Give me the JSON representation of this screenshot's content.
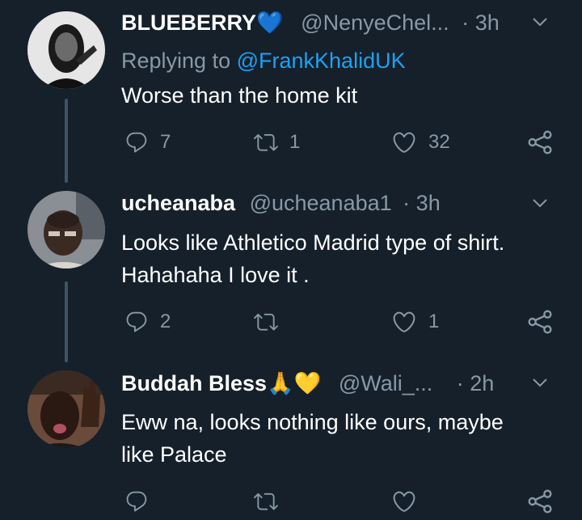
{
  "tweets": [
    {
      "name": "BLUEBERRY",
      "name_emoji": "💙",
      "handle": "@NenyeChel...",
      "dot": "·",
      "time": "3h",
      "replying_prefix": "Replying to",
      "replying_to": "@FrankKhalidUK",
      "text": "Worse than the home kit",
      "replies": "7",
      "retweets": "1",
      "likes": "32"
    },
    {
      "name": "ucheanaba",
      "name_emoji": "",
      "handle": "@ucheanaba1",
      "dot": "·",
      "time": "3h",
      "text_line1": "Looks like Athletico Madrid type of shirt.",
      "text_line2": "Hahahaha I love it .",
      "replies": "2",
      "retweets": "",
      "likes": "1"
    },
    {
      "name": "Buddah Bless",
      "name_emoji": "🙏💛",
      "handle": "@Wali_...",
      "dot": "·",
      "time": "2h",
      "text_line1": "Eww na, looks nothing like ours, maybe",
      "text_line2": "like Palace",
      "replies": "",
      "retweets": "",
      "likes": ""
    }
  ],
  "colors": {
    "background": "#15202b",
    "secondary_text": "#8899a6",
    "link": "#1da1f2",
    "thread_line": "#3d5466"
  },
  "icons": [
    "reply-icon",
    "retweet-icon",
    "like-icon",
    "share-icon",
    "chevron-down-icon",
    "blue-heart-icon",
    "praying-hands-icon",
    "yellow-heart-icon"
  ]
}
